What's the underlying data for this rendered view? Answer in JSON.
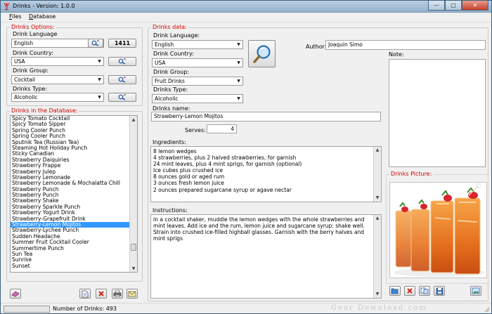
{
  "window": {
    "title": "Drinks - Version: 1.0.0"
  },
  "menu": {
    "files": "Files",
    "database": "Database"
  },
  "drinks_options": {
    "group_label": "Drinks Options:",
    "language_label": "Drink Language",
    "language_value": "English",
    "count_button": "1411",
    "country_label": "Drink Country:",
    "country_value": "USA",
    "group_field_label": "Drink Group:",
    "group_value": "Cocktail",
    "type_label": "Drinks Type:",
    "type_value": "Alcoholic"
  },
  "database": {
    "group_label": "Drinks in the Database:",
    "items": [
      "Spicy Tomato Cocktail",
      "Spicy Tomato Sipper",
      "Spring Cooler Punch",
      "Spring Cooler Punch",
      "Sputnik Tea (Russian Tea)",
      "Steaming Hot Holiday Punch",
      "Sticky Canadian",
      "Strawberry Daiquiries",
      "Strawberry Frappe",
      "Strawberry Julep",
      "Strawberry Lemonade",
      "Strawberry Lemonade & Mochalatta Chill",
      "Strawberry Punch",
      "Strawberry Punch",
      "Strawberry Shake",
      "Strawberry Sparkle Punch",
      "Strawberry Yogurt Drink",
      "Strawberry-Grapefruit Drink",
      "Strawberry-Lemon Mojitos",
      "Strawberry-Lychee Punch",
      "Sudden Headache",
      "Summer Fruit Cocktail Cooler",
      "Summertime Punch",
      "Sun Tea",
      "Sunrise",
      "Sunset"
    ],
    "selected_index": 18
  },
  "drinks_data": {
    "group_label": "Drinks data:",
    "language_label": "Drink Language:",
    "language_value": "English",
    "country_label": "Drink Country:",
    "country_value": "USA",
    "group_field_label": "Drink Group:",
    "group_value": "Fruit Drinks",
    "type_label": "Drinks Type:",
    "type_value": "Alcoholic",
    "author_label": "Author:",
    "author_value": "Joaquin Simo",
    "note_label": "Note:",
    "name_label": "Drinks name:",
    "name_value": "Strawberry-Lemon Mojitos",
    "serves_label": "Serves:",
    "serves_value": "4",
    "ingredients_label": "Ingredients:",
    "ingredients": [
      "8 lemon wedges",
      "4 strawberries, plus 2 halved strawberries, for garnish",
      "24 mint leaves, plus 4 mint sprigs, for garnish (optional)",
      "Ice cubes plus crushed ice",
      "8 ounces gold or aged rum",
      "3 ounces fresh lemon juice",
      "2 ounces prepared sugarcane syrup or agave nectar"
    ],
    "instructions_label": "Instructions:",
    "instructions": "In a cocktail shaker, muddle the lemon wedges with the whole strawberries and mint leaves. Add ice and the rum, lemon juice and sugarcane syrup; shake well. Strain into crushed ice-filled highball glasses. Garnish with the berry halves and mint sprigs",
    "picture_label": "Drinks Picture:"
  },
  "status": {
    "count_text": "Number of Drinks: 493"
  },
  "watermark": "Gear Download.com",
  "colors": {
    "group_label": "#cc0000",
    "selection": "#3399ff"
  }
}
